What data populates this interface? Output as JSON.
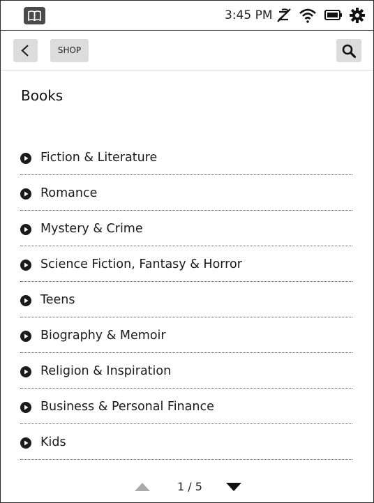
{
  "status": {
    "time": "3:45 PM",
    "icons": [
      "library-icon",
      "sync-off-icon",
      "wifi-icon",
      "battery-icon",
      "gear-icon"
    ]
  },
  "nav": {
    "shop_label": "SHOP"
  },
  "page": {
    "title": "Books"
  },
  "categories": [
    {
      "label": "Fiction & Literature"
    },
    {
      "label": "Romance"
    },
    {
      "label": "Mystery & Crime"
    },
    {
      "label": "Science Fiction, Fantasy & Horror"
    },
    {
      "label": "Teens"
    },
    {
      "label": "Biography & Memoir"
    },
    {
      "label": "Religion & Inspiration"
    },
    {
      "label": "Business & Personal Finance"
    },
    {
      "label": "Kids"
    }
  ],
  "pagination": {
    "indicator": "1 / 5",
    "current": 1,
    "total": 5
  },
  "colors": {
    "icon_dark": "#1a1a1a",
    "button_bg": "#dcdcdc",
    "disabled_arrow": "#aaaaaa"
  }
}
